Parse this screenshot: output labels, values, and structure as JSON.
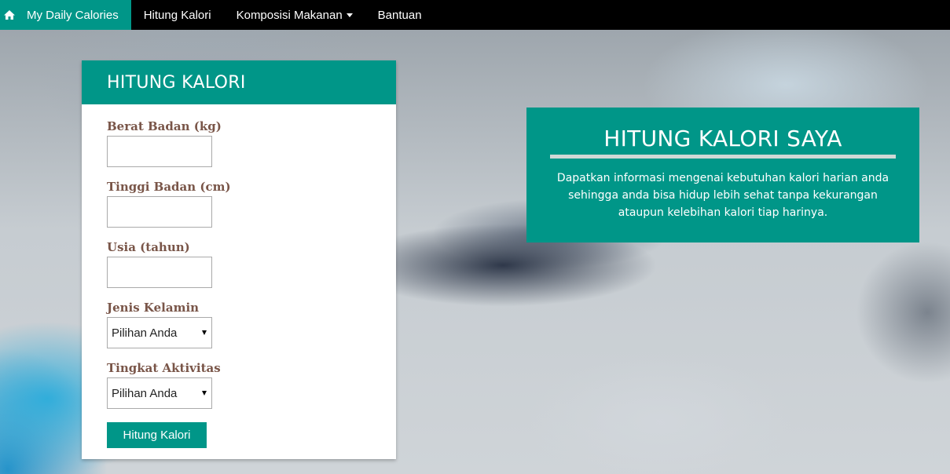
{
  "navbar": {
    "brand_label": "My Daily Calories",
    "brand_icon": "home-icon",
    "items": [
      {
        "label": "Hitung Kalori"
      },
      {
        "label": "Komposisi Makanan"
      },
      {
        "label": "Bantuan"
      }
    ]
  },
  "form": {
    "title": "HITUNG KALORI",
    "weight_label": "Berat Badan (kg)",
    "weight_value": "",
    "height_label": "Tinggi Badan (cm)",
    "height_value": "",
    "age_label": "Usia (tahun)",
    "age_value": "",
    "gender_label": "Jenis Kelamin",
    "gender_selected": "Pilihan Anda",
    "activity_label": "Tingkat Aktivitas",
    "activity_selected": "Pilihan Anda",
    "submit_label": "Hitung Kalori"
  },
  "info": {
    "title": "HITUNG KALORI SAYA",
    "text": "Dapatkan informasi mengenai kebutuhan kalori harian anda sehingga anda bisa hidup lebih sehat tanpa kekurangan ataupun kelebihan kalori tiap harinya."
  },
  "colors": {
    "accent": "#009688",
    "navbar": "#000000",
    "label": "#795548"
  }
}
